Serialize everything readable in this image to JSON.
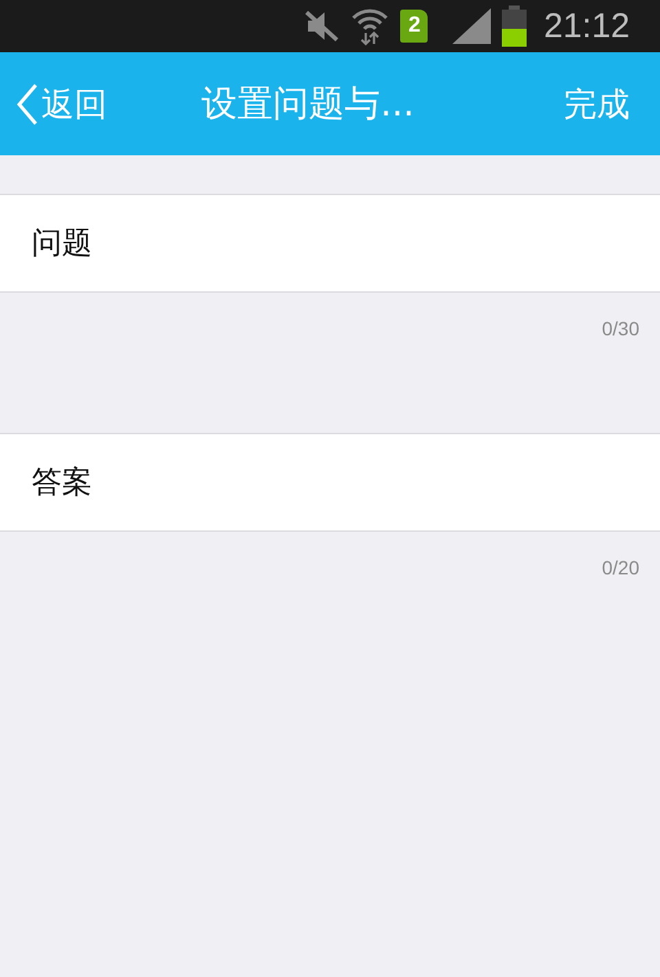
{
  "status_bar": {
    "sim_badge": "2",
    "time": "21:12"
  },
  "nav_bar": {
    "back": "返回",
    "title": "设置问题与...",
    "done": "完成"
  },
  "fields": [
    {
      "label": "问题",
      "counter": "0/30"
    },
    {
      "label": "答案",
      "counter": "0/20"
    }
  ]
}
